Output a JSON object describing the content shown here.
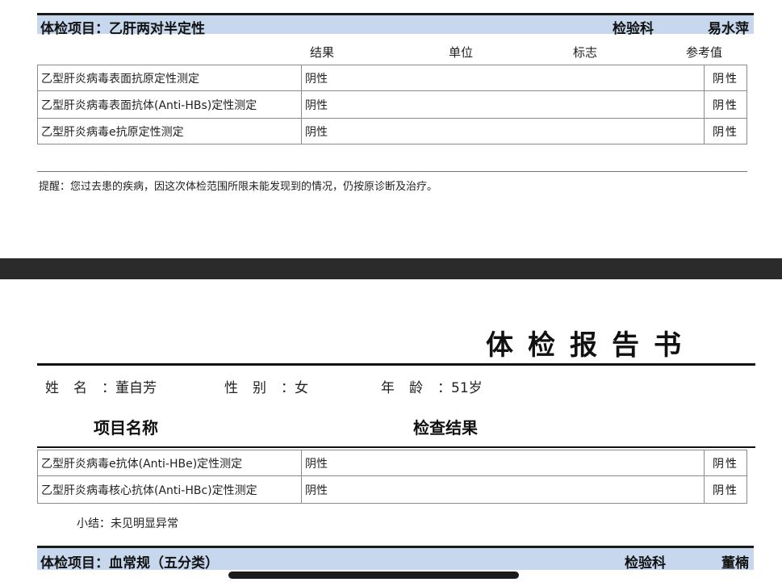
{
  "section1": {
    "title": "体检项目：乙肝两对半定性",
    "dept": "检验科",
    "doctor": "易水萍",
    "columns": {
      "result": "结果",
      "unit": "单位",
      "flag": "标志",
      "reference": "参考值"
    },
    "rows": [
      {
        "name": "乙型肝炎病毒表面抗原定性测定",
        "result": "阴性",
        "reference": "阴性"
      },
      {
        "name": "乙型肝炎病毒表面抗体(Anti-HBs)定性测定",
        "result": "阴性",
        "reference": "阴性"
      },
      {
        "name": "乙型肝炎病毒e抗原定性测定",
        "result": "阴性",
        "reference": "阴性"
      }
    ],
    "reminder": "提醒：您过去患的疾病，因这次体检范围所限未能发现到的情况，仍按原诊断及治疗。"
  },
  "report": {
    "title": "体检报告书",
    "patient": {
      "name_label": "姓名",
      "name_sep": "：",
      "name": "董自芳",
      "gender_label": "性别",
      "gender_sep": "：",
      "gender": "女",
      "age_label": "年龄",
      "age_sep": "：",
      "age": "51岁"
    },
    "item_header": "项目名称",
    "result_header": "检查结果",
    "rows": [
      {
        "name": "乙型肝炎病毒e抗体(Anti-HBe)定性测定",
        "result": "阴性",
        "reference": "阴性"
      },
      {
        "name": "乙型肝炎病毒核心抗体(Anti-HBc)定性测定",
        "result": "阴性",
        "reference": "阴性"
      }
    ],
    "summary": "小结：未见明显异常"
  },
  "section2": {
    "title": "体检项目：血常规（五分类）",
    "dept": "检验科",
    "doctor": "董楠"
  }
}
